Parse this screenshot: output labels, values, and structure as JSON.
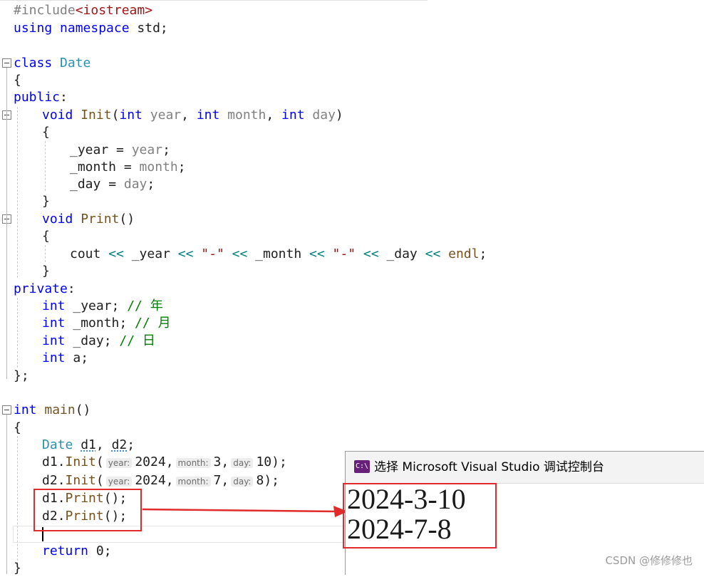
{
  "editor": {
    "lines": {
      "l1": {
        "pp": "#include",
        "inc": "<iostream>"
      },
      "l2": {
        "kw1": "using",
        "kw2": "namespace",
        "rest": " std;"
      },
      "l4": {
        "kw": "class",
        "ty": "Date"
      },
      "l5": {
        "t": "{"
      },
      "l6": {
        "kw": "public",
        "p": ":"
      },
      "l7": {
        "kw1": "void",
        "fn": "Init",
        "p1": "(",
        "kw2": "int",
        "pm1": "year",
        "p2": ", ",
        "kw3": "int",
        "pm2": "month",
        "p3": ", ",
        "kw4": "int",
        "pm3": "day",
        "p4": ")"
      },
      "l8": {
        "t": "{"
      },
      "l9": {
        "mb": "_year",
        "op": " = ",
        "pm": "year",
        "p": ";"
      },
      "l10": {
        "mb": "_month",
        "op": " = ",
        "pm": "month",
        "p": ";"
      },
      "l11": {
        "mb": "_day",
        "op": " = ",
        "pm": "day",
        "p": ";"
      },
      "l12": {
        "t": "}"
      },
      "l13": {
        "kw": "void",
        "fn": "Print",
        "p": "()"
      },
      "l14": {
        "t": "{"
      },
      "l15": {
        "a": "cout",
        "b": " << ",
        "c": "_year",
        "d": " << ",
        "e": "\"-\"",
        "f": " << ",
        "g": "_month",
        "h": " << ",
        "i": "\"-\"",
        "j": " << ",
        "k": "_day",
        "l": " << ",
        "m": "endl",
        "n": ";"
      },
      "l16": {
        "t": "}"
      },
      "l17": {
        "kw": "private",
        "p": ":"
      },
      "l18": {
        "kw": "int",
        "mb": " _year;",
        "cm": " // 年"
      },
      "l19": {
        "kw": "int",
        "mb": " _month;",
        "cm": " // 月"
      },
      "l20": {
        "kw": "int",
        "mb": " _day;",
        "cm": " // 日"
      },
      "l21": {
        "kw": "int",
        "mb": " a;"
      },
      "l22": {
        "t": "};"
      },
      "l24": {
        "kw": "int",
        "fn": " main",
        "p": "()"
      },
      "l25": {
        "t": "{"
      },
      "l26": {
        "ty": "Date",
        "a": " ",
        "v1": "d1",
        "b": ", ",
        "v2": "d2",
        "c": ";"
      },
      "l27": {
        "v": "d1",
        "dot": ".",
        "fn": "Init",
        "p1": "(",
        "h1": "year:",
        "n1": "2024,",
        "h2": "month:",
        "n2": "3,",
        "h3": "day:",
        "n3": "10",
        "p2": ");"
      },
      "l28": {
        "v": "d2",
        "dot": ".",
        "fn": "Init",
        "p1": "(",
        "h1": "year:",
        "n1": "2024,",
        "h2": "month:",
        "n2": "7,",
        "h3": "day:",
        "n3": "8",
        "p2": ");"
      },
      "l29": {
        "v": "d1",
        "dot": ".",
        "fn": "Print",
        "p": "();"
      },
      "l30": {
        "v": "d2",
        "dot": ".",
        "fn": "Print",
        "p": "();"
      },
      "l32": {
        "kw": "return",
        "n": " 0;"
      },
      "l33": {
        "t": "}"
      }
    }
  },
  "console": {
    "icon_label": "C:\\",
    "title": "选择 Microsoft Visual Studio 调试控制台",
    "output": [
      "2024-3-10",
      "2024-7-8"
    ]
  },
  "watermark": "CSDN @修修修也",
  "colors": {
    "highlight_box": "#e22a2a",
    "arrow": "#e22a2a",
    "console_icon": "#68217a"
  }
}
